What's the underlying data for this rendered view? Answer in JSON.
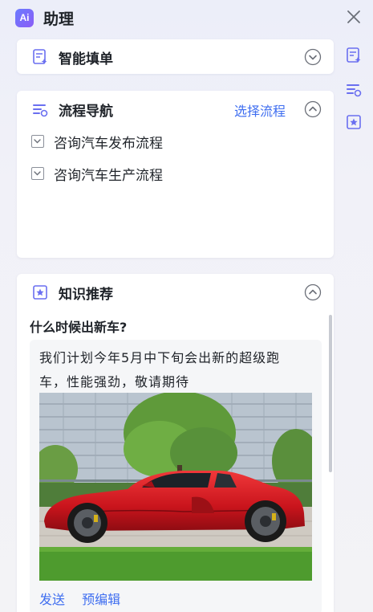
{
  "header": {
    "logo_text": "Ai",
    "title": "助理"
  },
  "smart_form": {
    "title": "智能填单"
  },
  "flow_nav": {
    "title": "流程导航",
    "select_label": "选择流程",
    "items": [
      {
        "label": "咨询汽车发布流程"
      },
      {
        "label": "咨询汽车生产流程"
      }
    ]
  },
  "knowledge": {
    "title": "知识推荐",
    "question": "什么时候出新车?",
    "answer_line1": "我们计划今年5月中下旬会出新的超级跑",
    "answer_line2": "车，性能强劲，敬请期待",
    "send_label": "发送",
    "edit_label": "预编辑"
  },
  "colors": {
    "accent": "#3f6ef0",
    "icon": "#6a6ff0",
    "text": "#1f2329"
  },
  "icons": [
    "close-icon",
    "form-icon",
    "flow-icon",
    "knowledge-icon",
    "chevron-down-icon",
    "chevron-up-icon"
  ]
}
